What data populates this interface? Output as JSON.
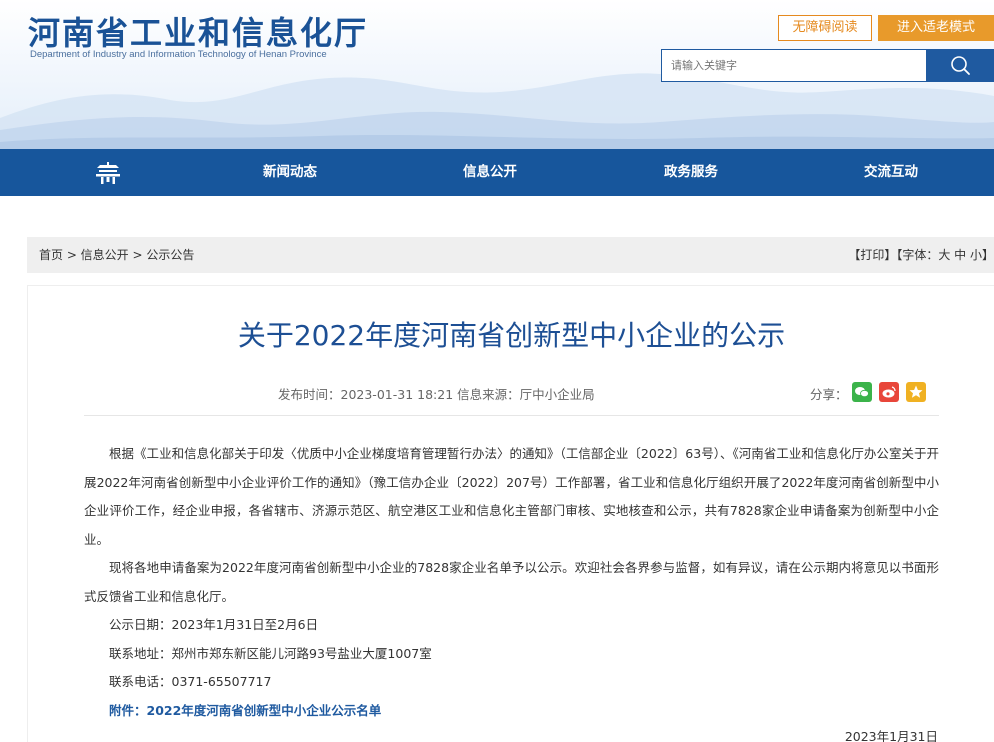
{
  "header": {
    "title_cn": "河南省工业和信息化厅",
    "title_en": "Department of Industry and Information Technology of Henan Province",
    "accessible_label": "无障碍阅读",
    "elder_mode_label": "进入适老模式",
    "search_placeholder": "请输入关键字"
  },
  "nav": {
    "items": [
      {
        "label": "新闻动态"
      },
      {
        "label": "信息公开"
      },
      {
        "label": "政务服务"
      },
      {
        "label": "交流互动"
      }
    ]
  },
  "breadcrumb": {
    "text": "首页 > 信息公开 > 公示公告",
    "tools": "【打印】【字体：大 中 小】"
  },
  "article": {
    "title": "关于2022年度河南省创新型中小企业的公示",
    "meta": "发布时间：2023-01-31 18:21   信息来源：厅中小企业局",
    "share_label": "分享：",
    "share_icons": [
      "wechat-icon",
      "weibo-icon",
      "favorite-icon"
    ],
    "paragraphs": [
      "根据《工业和信息化部关于印发〈优质中小企业梯度培育管理暂行办法〉的通知》（工信部企业〔2022〕63号）、《河南省工业和信息化厅办公室关于开展2022年河南省创新型中小企业评价工作的通知》（豫工信办企业〔2022〕207号）工作部署，省工业和信息化厅组织开展了2022年度河南省创新型中小企业评价工作，经企业申报，各省辖市、济源示范区、航空港区工业和信息化主管部门审核、实地核查和公示，共有7828家企业申请备案为创新型中小企业。",
      "现将各地申请备案为2022年度河南省创新型中小企业的7828家企业名单予以公示。欢迎社会各界参与监督，如有异议，请在公示期内将意见以书面形式反馈省工业和信息化厅。",
      "公示日期：2023年1月31日至2月6日",
      "联系地址：郑州市郑东新区能儿河路93号盐业大厦1007室",
      "联系电话：0371-65507717"
    ],
    "attachment": "附件：2022年度河南省创新型中小企业公示名单",
    "date": "2023年1月31日"
  },
  "colors": {
    "brand_blue": "#17569c",
    "title_blue": "#1d4f94",
    "orange": "#e89a2b"
  }
}
